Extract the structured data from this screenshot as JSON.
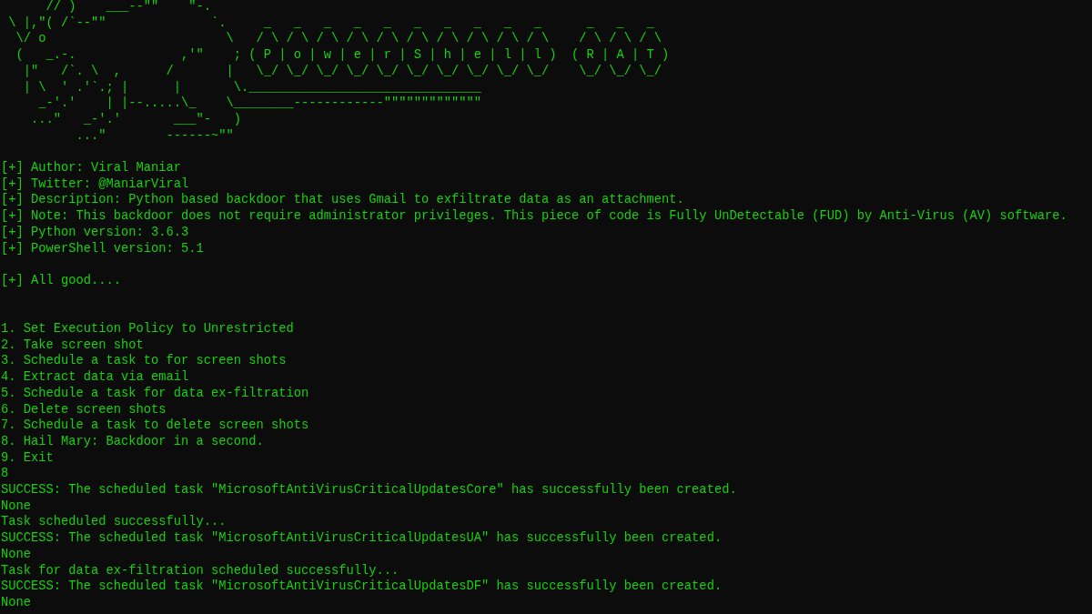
{
  "banner": {
    "art_lines": [
      "      // )    ___--\"\"    \"-.",
      " \\ |,\"( /`--\"\"              `.     _   _   _   _   _   _   _   _   _   _      _   _   _",
      "  \\/ o                        \\   / \\ / \\ / \\ / \\ / \\ / \\ / \\ / \\ / \\ / \\    / \\ / \\ / \\",
      "  (   _.-.              ,'\"    ; ( P | o | w | e | r | S | h | e | l | l )  ( R | A | T )",
      "   |\"   /`. \\  ,      /       |   \\_/ \\_/ \\_/ \\_/ \\_/ \\_/ \\_/ \\_/ \\_/ \\_/    \\_/ \\_/ \\_/",
      "   | \\  ' .'`.; |      |       \\._______________________________",
      "     _-'.'    | |--.....\\_    \\________------------\"\"\"\"\"\"\"\"\"\"\"\"\"",
      "    ...\"   _-'.'       ___\"-   )",
      "          ...\"        ------~\"\""
    ]
  },
  "info": [
    "[+] Author: Viral Maniar",
    "[+] Twitter: @ManiarViral",
    "[+] Description: Python based backdoor that uses Gmail to exfiltrate data as an attachment.",
    "[+] Note: This backdoor does not require administrator privileges. This piece of code is Fully UnDetectable (FUD) by Anti-Virus (AV) software.",
    "[+] Python version: 3.6.3",
    "[+] PowerShell version: 5.1"
  ],
  "status": "[+] All good....",
  "menu": [
    "1. Set Execution Policy to Unrestricted",
    "2. Take screen shot",
    "3. Schedule a task to for screen shots",
    "4. Extract data via email",
    "5. Schedule a task for data ex-filtration",
    "6. Delete screen shots",
    "7. Schedule a task to delete screen shots",
    "8. Hail Mary: Backdoor in a second.",
    "9. Exit"
  ],
  "output": [
    "8",
    "SUCCESS: The scheduled task \"MicrosoftAntiVirusCriticalUpdatesCore\" has successfully been created.",
    "None",
    "Task scheduled successfully...",
    "SUCCESS: The scheduled task \"MicrosoftAntiVirusCriticalUpdatesUA\" has successfully been created.",
    "None",
    "Task for data ex-filtration scheduled successfully...",
    "SUCCESS: The scheduled task \"MicrosoftAntiVirusCriticalUpdatesDF\" has successfully been created.",
    "None"
  ]
}
